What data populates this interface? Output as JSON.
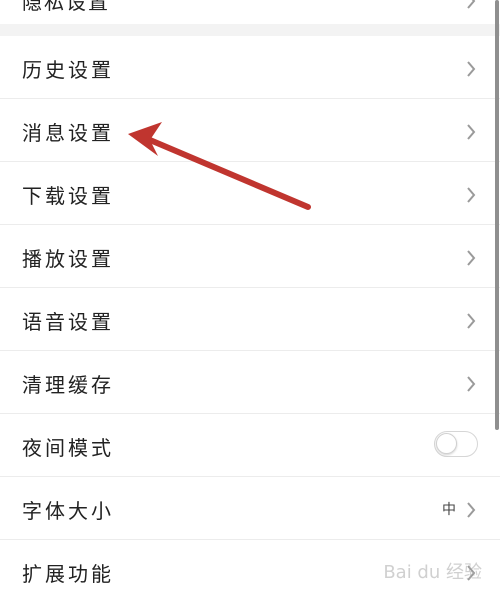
{
  "top_clipped_item": {
    "label": "隐私设置"
  },
  "settings": [
    {
      "label": "历史设置"
    },
    {
      "label": "消息设置"
    },
    {
      "label": "下载设置"
    },
    {
      "label": "播放设置"
    },
    {
      "label": "语音设置"
    },
    {
      "label": "清理缓存"
    }
  ],
  "night_mode": {
    "label": "夜间模式",
    "enabled": false
  },
  "font_size": {
    "label": "字体大小",
    "value": "中"
  },
  "extensions": {
    "label": "扩展功能"
  },
  "watermark": {
    "text": "Bai du 经验"
  },
  "colors": {
    "annotation_arrow": "#c0352f",
    "divider": "#ececec",
    "section_gap": "#f3f3f3",
    "chevron": "#9a9a9a"
  },
  "icons": {
    "chevron": "chevron-right-icon",
    "toggle": "toggle-switch"
  }
}
